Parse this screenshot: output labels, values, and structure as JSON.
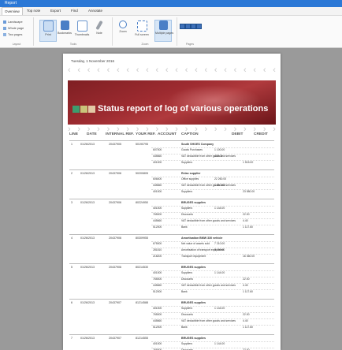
{
  "window": {
    "title": "Report"
  },
  "tabs": [
    {
      "label": "Overview",
      "active": true
    },
    {
      "label": "Top note"
    },
    {
      "label": "Export"
    },
    {
      "label": "Find"
    },
    {
      "label": "Annotate"
    }
  ],
  "ribbon": {
    "groups": [
      {
        "label": "Layout",
        "options": [
          "Landscape",
          "Whole page",
          "Two pages"
        ]
      },
      {
        "label": "Tools",
        "buttons": [
          "Print",
          "Bookmarks",
          "Thumbnails",
          "Note"
        ]
      },
      {
        "label": "Zoom",
        "buttons": [
          "Zoom",
          "Full screen",
          "Multiple pages"
        ]
      },
      {
        "label": "Pages"
      }
    ]
  },
  "report": {
    "date": "Tuesday, 1 November 2016",
    "title": "Status report of log of various operations",
    "columns": [
      "LINE",
      "DATE",
      "INTERNAL REF.",
      "YOUR REF.",
      "ACCOUNT",
      "CAPTION",
      "DEBIT",
      "CREDIT"
    ],
    "records": [
      {
        "line": "1",
        "date": "01/26/2013",
        "internal": "20437905",
        "yourref": "50190795",
        "header": "South SHOES Company",
        "lines": [
          {
            "acc": "607000",
            "cap": "Goods Purchases",
            "debit": "1 100.00",
            "credit": ""
          },
          {
            "acc": "445660",
            "cap": "VAT deductible from other goods and services",
            "debit": "415.00",
            "credit": ""
          },
          {
            "acc": "401000",
            "cap": "Suppliers",
            "debit": "",
            "credit": "1 515.00"
          }
        ]
      },
      {
        "line": "2",
        "date": "01/26/2013",
        "internal": "20437906",
        "yourref": "50200805",
        "header": "Relax supplier",
        "lines": [
          {
            "acc": "606400",
            "cap": "Office supplies",
            "debit": "22 260.00",
            "credit": ""
          },
          {
            "acc": "445660",
            "cap": "VAT deductible from other goods and services",
            "debit": "1 360.00",
            "credit": ""
          },
          {
            "acc": "401000",
            "cap": "Suppliers",
            "debit": "",
            "credit": "23 580.00"
          }
        ]
      },
      {
        "line": "3",
        "date": "01/26/2013",
        "internal": "20437906",
        "yourref": "80224950",
        "header": "BRUGES supplies",
        "lines": [
          {
            "acc": "401000",
            "cap": "Suppliers",
            "debit": "1 144.00",
            "credit": ""
          },
          {
            "acc": "765000",
            "cap": "Discounts",
            "debit": "",
            "credit": "22.00"
          },
          {
            "acc": "445660",
            "cap": "VAT deductible from other goods and services",
            "debit": "",
            "credit": "4.40"
          },
          {
            "acc": "512000",
            "cap": "Bank",
            "debit": "",
            "credit": "1 117.60"
          }
        ]
      },
      {
        "line": "4",
        "date": "01/26/2013",
        "internal": "20437906",
        "yourref": "80309955",
        "header": "Amortisation BMW 330 vehicle",
        "lines": [
          {
            "acc": "675000",
            "cap": "Net value of assets sold",
            "debit": "7 210.00",
            "credit": ""
          },
          {
            "acc": "281810",
            "cap": "Amortisation of transport equipment",
            "debit": "9 150.00",
            "credit": ""
          },
          {
            "acc": "218200",
            "cap": "Transport equipment",
            "debit": "",
            "credit": "16 360.00"
          }
        ]
      },
      {
        "line": "5",
        "date": "01/26/2013",
        "internal": "20437906",
        "yourref": "80214530",
        "header": "BRUGES supplies",
        "lines": [
          {
            "acc": "401000",
            "cap": "Suppliers",
            "debit": "1 144.00",
            "credit": ""
          },
          {
            "acc": "765000",
            "cap": "Discounts",
            "debit": "",
            "credit": "22.00"
          },
          {
            "acc": "445660",
            "cap": "VAT deductible from other goods and services",
            "debit": "",
            "credit": "4.40"
          },
          {
            "acc": "512000",
            "cap": "Bank",
            "debit": "",
            "credit": "1 117.60"
          }
        ]
      },
      {
        "line": "6",
        "date": "01/26/2013",
        "internal": "20437907",
        "yourref": "81214588",
        "header": "BRUGES supplies",
        "lines": [
          {
            "acc": "401000",
            "cap": "Suppliers",
            "debit": "1 144.00",
            "credit": ""
          },
          {
            "acc": "765000",
            "cap": "Discounts",
            "debit": "",
            "credit": "22.00"
          },
          {
            "acc": "445660",
            "cap": "VAT deductible from other goods and services",
            "debit": "",
            "credit": "4.40"
          },
          {
            "acc": "512000",
            "cap": "Bank",
            "debit": "",
            "credit": "1 117.60"
          }
        ]
      },
      {
        "line": "7",
        "date": "01/26/2013",
        "internal": "20437907",
        "yourref": "81214555",
        "header": "BRUGES supplies",
        "lines": [
          {
            "acc": "401000",
            "cap": "Suppliers",
            "debit": "1 144.00",
            "credit": ""
          },
          {
            "acc": "765000",
            "cap": "Discounts",
            "debit": "",
            "credit": "22.00"
          }
        ]
      }
    ]
  },
  "colors": {
    "titlebar": "#2b78d6",
    "banner": "#8f2428",
    "square1": "#3d9c6e",
    "square2": "#c9c47a",
    "square3": "#e3c9a6"
  }
}
